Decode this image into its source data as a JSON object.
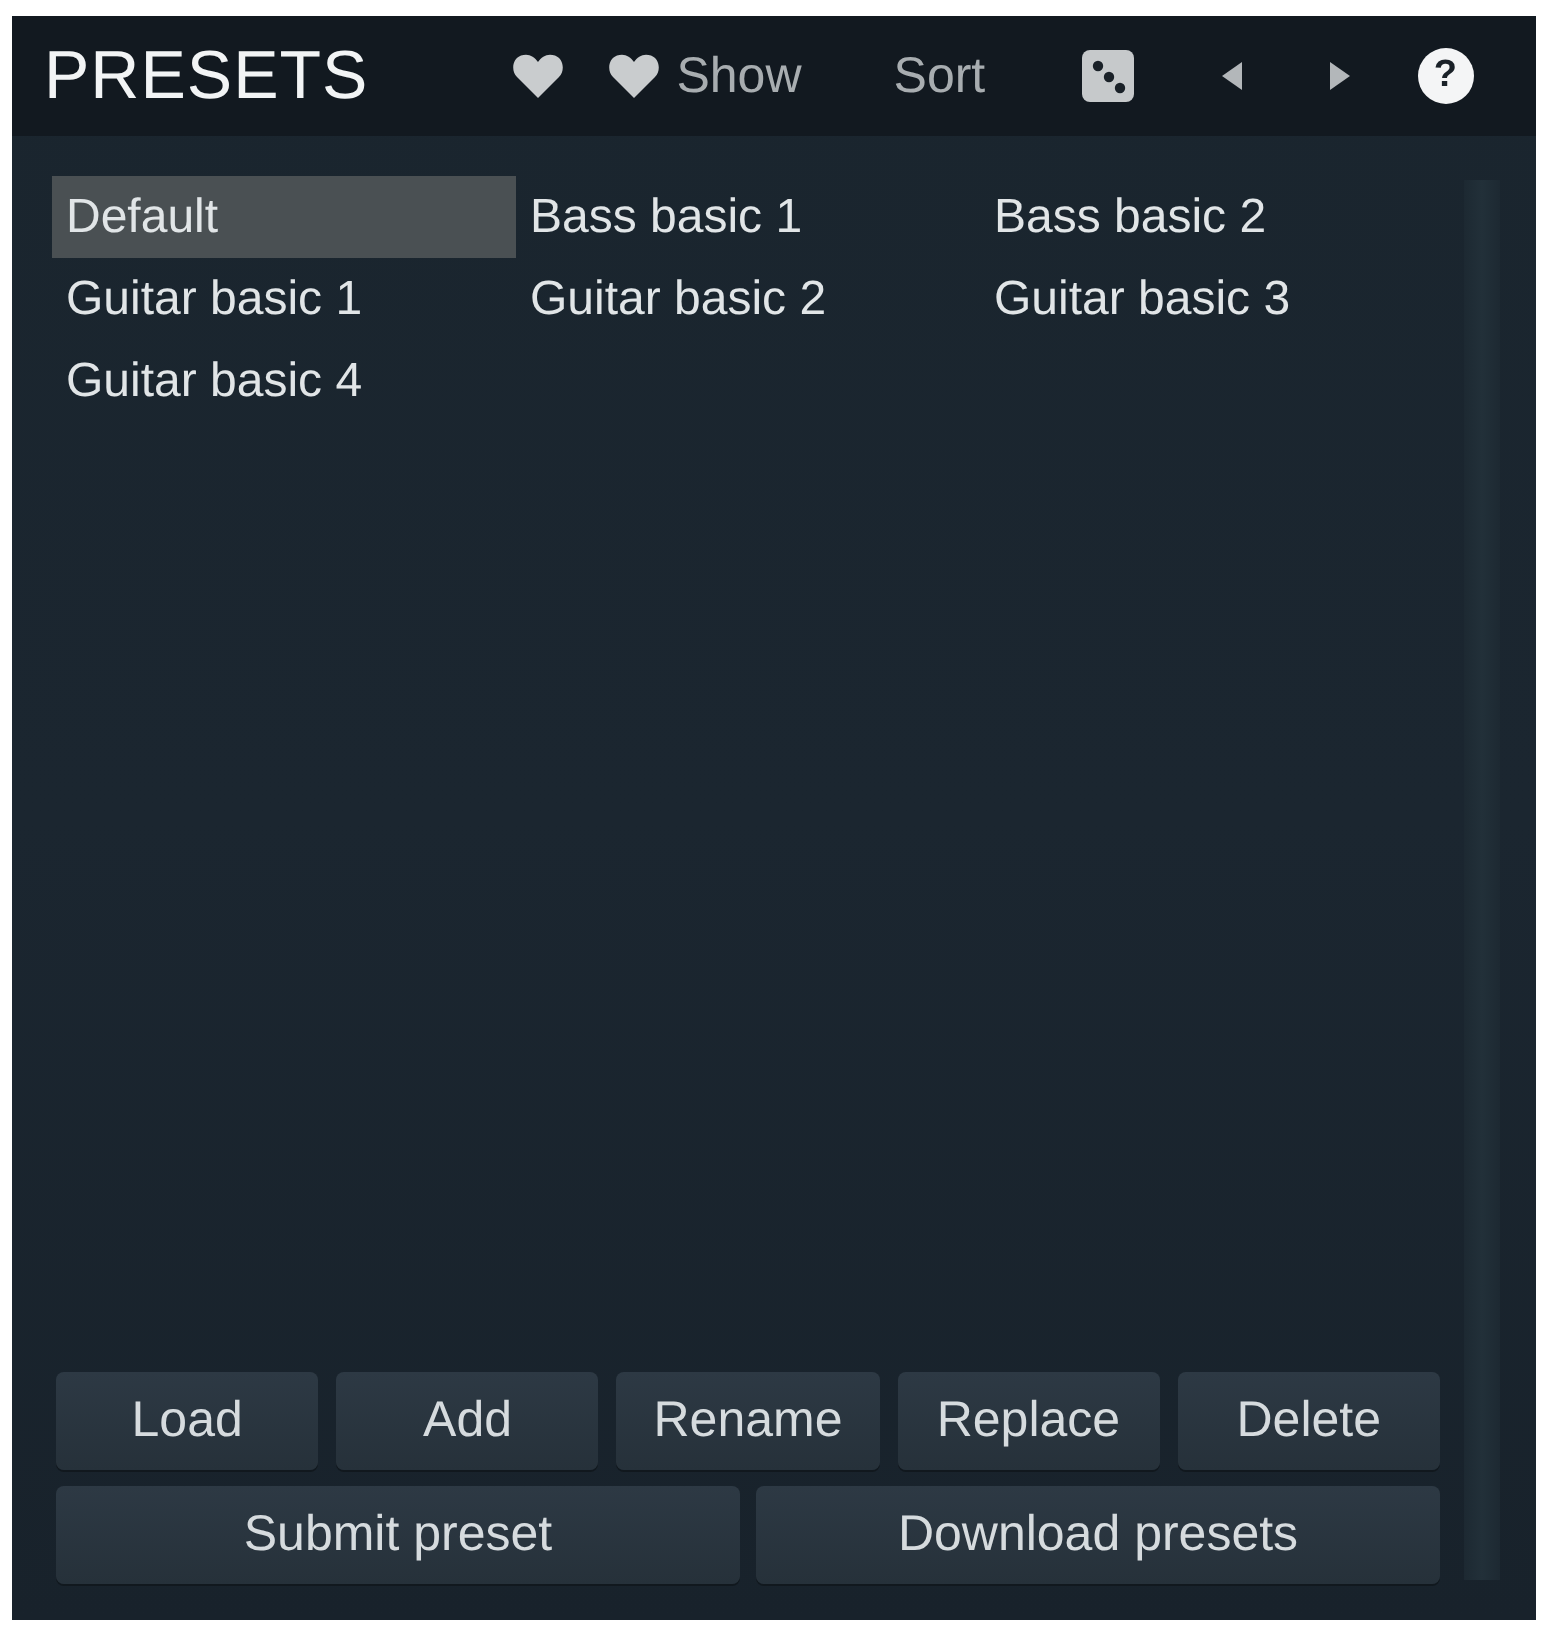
{
  "panel": {
    "title": "PRESETS",
    "toolbar": {
      "show_label": "Show",
      "sort_label": "Sort",
      "help_label": "?"
    }
  },
  "presets": [
    {
      "name": "Default",
      "selected": true
    },
    {
      "name": "Bass basic 1",
      "selected": false
    },
    {
      "name": "Bass basic 2",
      "selected": false
    },
    {
      "name": "Guitar basic 1",
      "selected": false
    },
    {
      "name": "Guitar basic 2",
      "selected": false
    },
    {
      "name": "Guitar basic 3",
      "selected": false
    },
    {
      "name": "Guitar basic 4",
      "selected": false
    }
  ],
  "buttons": [
    {
      "label": "Load"
    },
    {
      "label": "Add"
    },
    {
      "label": "Rename"
    },
    {
      "label": "Replace"
    },
    {
      "label": "Delete"
    }
  ],
  "wide_buttons": [
    {
      "label": "Submit preset"
    },
    {
      "label": "Download presets"
    }
  ]
}
